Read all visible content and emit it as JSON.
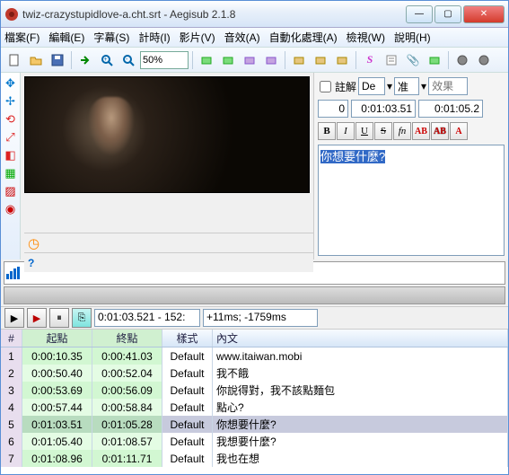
{
  "window": {
    "title": "twiz-crazystupidlove-a.cht.srt - Aegisub 2.1.8"
  },
  "menu": {
    "file": "檔案(F)",
    "edit": "編輯(E)",
    "subs": "字幕(S)",
    "timing": "計時(I)",
    "video": "影片(V)",
    "audio": "音效(A)",
    "automation": "自動化處理(A)",
    "view": "檢視(W)",
    "help": "說明(H)"
  },
  "toolbar": {
    "zoom": "50%"
  },
  "editpanel": {
    "comment_label": "註解",
    "style": "De",
    "actor": "准",
    "effect_placeholder": "效果",
    "margin_l": "0",
    "start": "0:01:03.51",
    "end": "0:01:05.2",
    "text": "你想要什麼?"
  },
  "playbar": {
    "pos": "0:01:03.521 - 152:",
    "offset": "+11ms; -1759ms"
  },
  "grid": {
    "headers": {
      "num": "#",
      "start": "起點",
      "end": "終點",
      "style": "樣式",
      "text": "內文"
    },
    "rows": [
      {
        "n": "1",
        "start": "0:00:10.35",
        "end": "0:00:41.03",
        "style": "Default",
        "text": "www.itaiwan.mobi"
      },
      {
        "n": "2",
        "start": "0:00:50.40",
        "end": "0:00:52.04",
        "style": "Default",
        "text": "我不餓"
      },
      {
        "n": "3",
        "start": "0:00:53.69",
        "end": "0:00:56.09",
        "style": "Default",
        "text": "你說得對，我不該點麵包"
      },
      {
        "n": "4",
        "start": "0:00:57.44",
        "end": "0:00:58.84",
        "style": "Default",
        "text": "點心?"
      },
      {
        "n": "5",
        "start": "0:01:03.51",
        "end": "0:01:05.28",
        "style": "Default",
        "text": "你想要什麼?"
      },
      {
        "n": "6",
        "start": "0:01:05.40",
        "end": "0:01:08.57",
        "style": "Default",
        "text": "我想要什麼?"
      },
      {
        "n": "7",
        "start": "0:01:08.96",
        "end": "0:01:11.71",
        "style": "Default",
        "text": "我也在想"
      }
    ],
    "selected": 4
  }
}
